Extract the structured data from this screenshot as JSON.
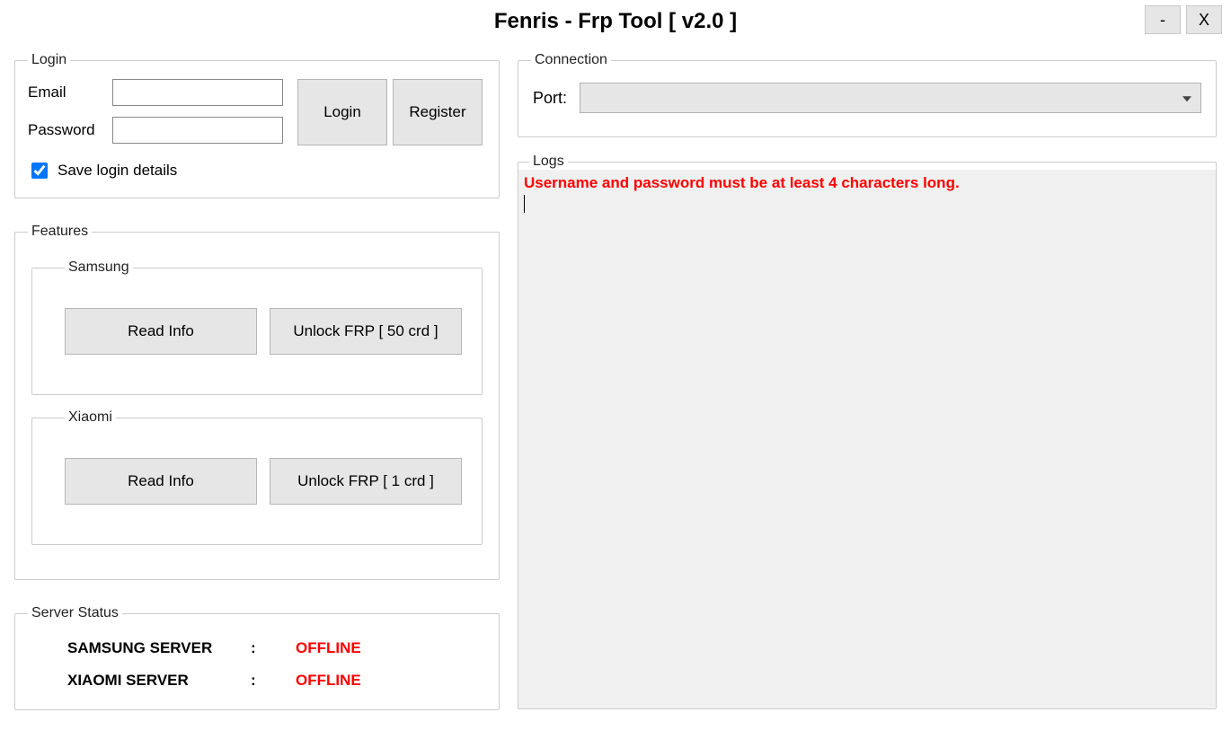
{
  "window": {
    "title": "Fenris - Frp Tool [ v2.0 ]",
    "minimize": "-",
    "close": "X"
  },
  "login": {
    "legend": "Login",
    "email_label": "Email",
    "email_value": "",
    "password_label": "Password",
    "password_value": "",
    "login_btn": "Login",
    "register_btn": "Register",
    "save_label": "Save login details",
    "save_checked": true
  },
  "features": {
    "legend": "Features",
    "samsung": {
      "legend": "Samsung",
      "read_info": "Read Info",
      "unlock": "Unlock FRP [ 50 crd ]"
    },
    "xiaomi": {
      "legend": "Xiaomi",
      "read_info": "Read Info",
      "unlock": "Unlock FRP [ 1 crd ]"
    }
  },
  "server_status": {
    "legend": "Server Status",
    "rows": [
      {
        "name": "SAMSUNG SERVER",
        "colon": ":",
        "status": "OFFLINE"
      },
      {
        "name": "XIAOMI SERVER",
        "colon": ":",
        "status": "OFFLINE"
      }
    ]
  },
  "connection": {
    "legend": "Connection",
    "port_label": "Port:",
    "port_value": ""
  },
  "logs": {
    "legend": "Logs",
    "lines": [
      "Username and password must be at least 4 characters long."
    ]
  }
}
